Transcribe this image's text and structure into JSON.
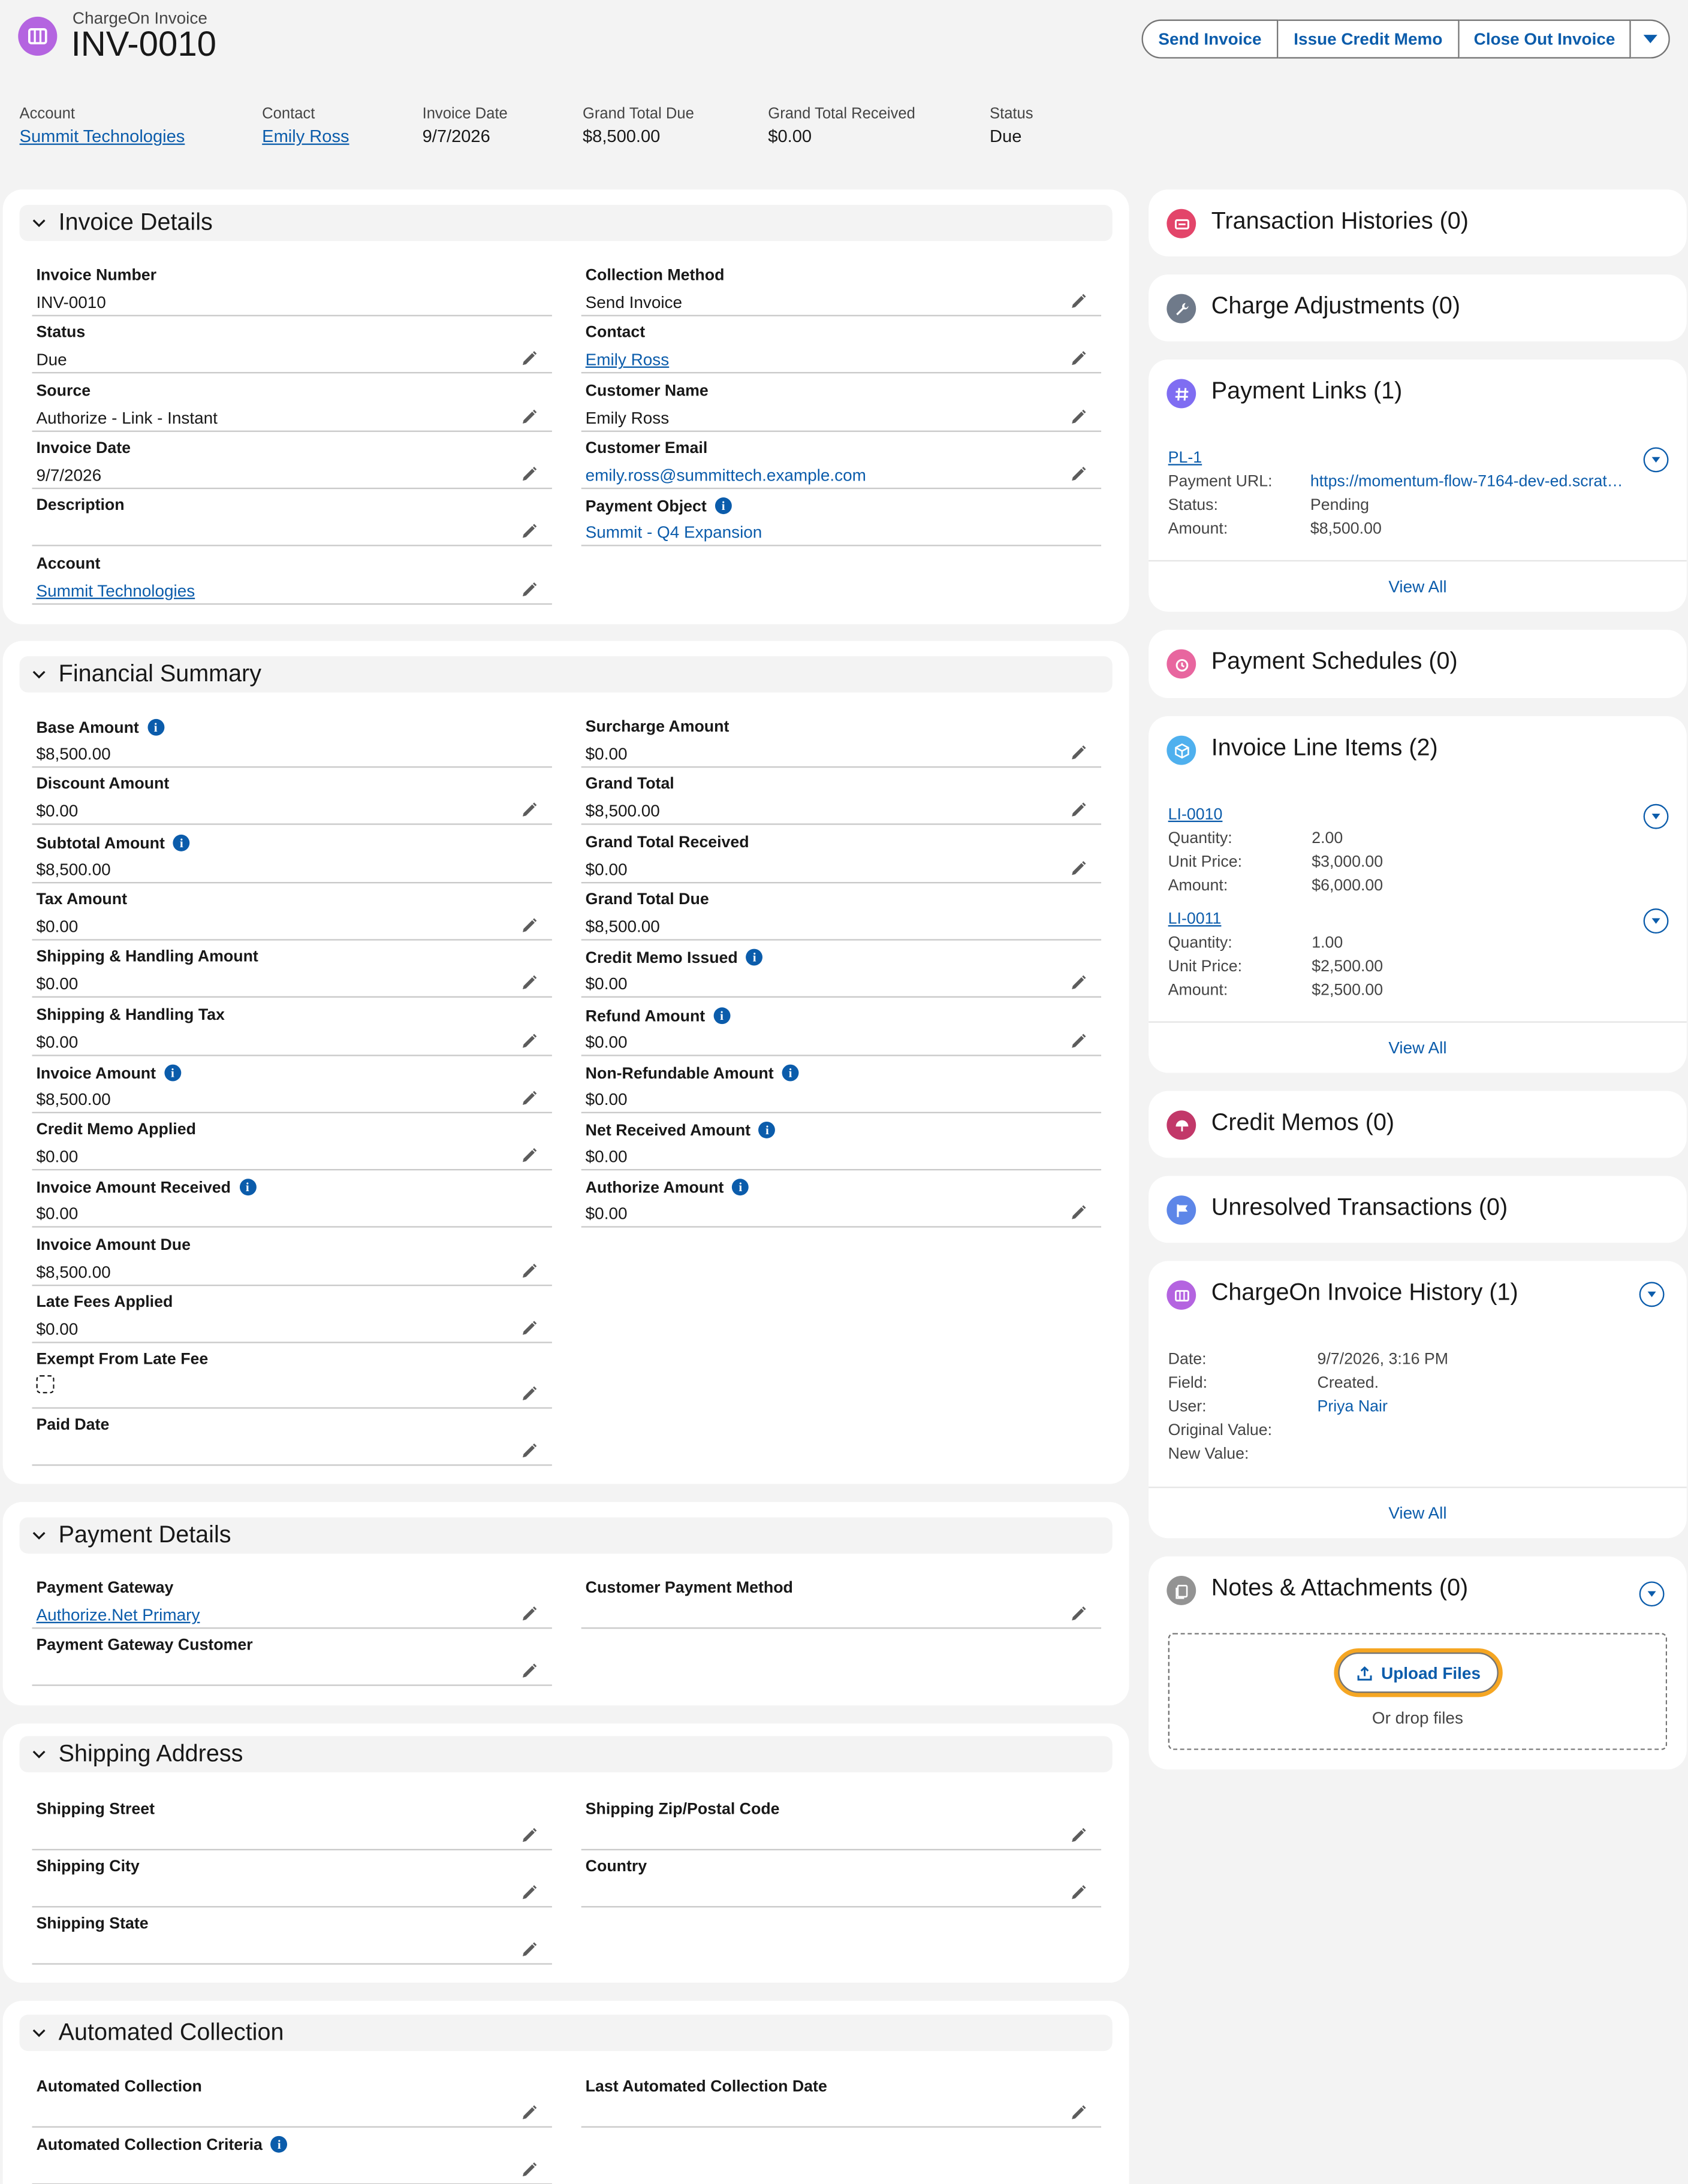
{
  "header": {
    "object_label": "ChargeOn Invoice",
    "title": "INV-0010",
    "buttons": [
      "Send Invoice",
      "Issue Credit Memo",
      "Close Out Invoice"
    ],
    "highlights": [
      {
        "label": "Account",
        "value": "Summit Technologies",
        "link": true
      },
      {
        "label": "Contact",
        "value": "Emily Ross",
        "link": true
      },
      {
        "label": "Invoice Date",
        "value": "9/7/2026",
        "link": false
      },
      {
        "label": "Grand Total Due",
        "value": "$8,500.00",
        "link": false
      },
      {
        "label": "Grand Total Received",
        "value": "$0.00",
        "link": false
      },
      {
        "label": "Status",
        "value": "Due",
        "link": false
      }
    ]
  },
  "invoice_details": {
    "title": "Invoice Details",
    "left": [
      {
        "label": "Invoice Number",
        "value": "INV-0010"
      },
      {
        "label": "Status",
        "value": "Due"
      },
      {
        "label": "Source",
        "value": "Authorize - Link - Instant"
      },
      {
        "label": "Invoice Date",
        "value": "9/7/2026"
      },
      {
        "label": "Description",
        "value": ""
      },
      {
        "label": "Account",
        "value": "Summit Technologies"
      }
    ],
    "right": [
      {
        "label": "Collection Method",
        "value": "Send Invoice"
      },
      {
        "label": "Contact",
        "value": "Emily Ross"
      },
      {
        "label": "Customer Name",
        "value": "Emily Ross"
      },
      {
        "label": "Customer Email",
        "value": "emily.ross@summittech.example.com"
      },
      {
        "label": "Payment Object",
        "value": "Summit - Q4 Expansion"
      }
    ]
  },
  "financial_summary": {
    "title": "Financial Summary",
    "left": [
      {
        "label": "Base Amount",
        "value": "$8,500.00"
      },
      {
        "label": "Discount Amount",
        "value": "$0.00"
      },
      {
        "label": "Subtotal Amount",
        "value": "$8,500.00"
      },
      {
        "label": "Tax Amount",
        "value": "$0.00"
      },
      {
        "label": "Shipping & Handling Amount",
        "value": "$0.00"
      },
      {
        "label": "Shipping & Handling Tax",
        "value": "$0.00"
      },
      {
        "label": "Invoice Amount",
        "value": "$8,500.00"
      },
      {
        "label": "Credit Memo Applied",
        "value": "$0.00"
      },
      {
        "label": "Invoice Amount Received",
        "value": "$0.00"
      },
      {
        "label": "Invoice Amount Due",
        "value": "$8,500.00"
      },
      {
        "label": "Late Fees Applied",
        "value": "$0.00"
      },
      {
        "label": "Exempt From Late Fee",
        "value": ""
      },
      {
        "label": "Paid Date",
        "value": ""
      }
    ],
    "right": [
      {
        "label": "Surcharge Amount",
        "value": "$0.00"
      },
      {
        "label": "Grand Total",
        "value": "$8,500.00"
      },
      {
        "label": "Grand Total Received",
        "value": "$0.00"
      },
      {
        "label": "Grand Total Due",
        "value": "$8,500.00"
      },
      {
        "label": "Credit Memo Issued",
        "value": "$0.00"
      },
      {
        "label": "Refund Amount",
        "value": "$0.00"
      },
      {
        "label": "Non-Refundable Amount",
        "value": "$0.00"
      },
      {
        "label": "Net Received Amount",
        "value": "$0.00"
      },
      {
        "label": "Authorize Amount",
        "value": "$0.00"
      }
    ]
  },
  "payment_details": {
    "title": "Payment Details",
    "fields": [
      {
        "label": "Payment Gateway",
        "value": "Authorize.Net Primary"
      },
      {
        "label": "Customer Payment Method",
        "value": ""
      },
      {
        "label": "Payment Gateway Customer",
        "value": ""
      }
    ]
  },
  "shipping_address": {
    "title": "Shipping Address",
    "fields": [
      {
        "label": "Shipping Street",
        "value": ""
      },
      {
        "label": "Shipping Zip/Postal Code",
        "value": ""
      },
      {
        "label": "Shipping City",
        "value": ""
      },
      {
        "label": "Country",
        "value": ""
      },
      {
        "label": "Shipping State",
        "value": ""
      }
    ]
  },
  "automated_collection": {
    "title": "Automated Collection",
    "fields": [
      {
        "label": "Automated Collection",
        "value": ""
      },
      {
        "label": "Last Automated Collection Date",
        "value": ""
      },
      {
        "label": "Automated Collection Criteria",
        "value": ""
      }
    ]
  },
  "related": {
    "transaction_histories": "Transaction Histories (0)",
    "charge_adjustments": "Charge Adjustments (0)",
    "payment_links": {
      "title": "Payment Links (1)",
      "item": {
        "name": "PL-1",
        "url_label": "Payment URL:",
        "url": "https://momentum-flow-7164-dev-ed.scrat…",
        "status_label": "Status:",
        "status": "Pending",
        "amount_label": "Amount:",
        "amount": "$8,500.00"
      }
    },
    "payment_schedules": "Payment Schedules (0)",
    "invoice_line_items": {
      "title": "Invoice Line Items (2)",
      "items": [
        {
          "name": "LI-0010",
          "quantity": "2.00",
          "unit_price": "$3,000.00",
          "amount": "$6,000.00"
        },
        {
          "name": "LI-0011",
          "quantity": "1.00",
          "unit_price": "$2,500.00",
          "amount": "$2,500.00"
        }
      ],
      "labels": {
        "quantity": "Quantity:",
        "unit_price": "Unit Price:",
        "amount": "Amount:"
      }
    },
    "credit_memos": "Credit Memos (0)",
    "unresolved_transactions": "Unresolved Transactions (0)",
    "invoice_history": {
      "title": "ChargeOn Invoice History (1)",
      "labels": {
        "date": "Date:",
        "field": "Field:",
        "user": "User:",
        "original": "Original Value:",
        "new": "New Value:"
      },
      "date": "9/7/2026, 3:16 PM",
      "field": "Created.",
      "user": "Priya Nair"
    },
    "notes": {
      "title": "Notes & Attachments (0)",
      "upload_label": "Upload Files",
      "drop_label": "Or drop files"
    },
    "view_all": "View All"
  },
  "colors": {
    "link": "#0b5cab",
    "invoice_icon": "#b464e0",
    "transaction_icon": "#e3456a",
    "adjustment_icon": "#7e8be4",
    "payment_links_icon": "#7f6df2",
    "schedules_icon": "#e8669f",
    "line_items_icon": "#4fb0ee",
    "credit_memo_icon": "#c23869",
    "unresolved_icon": "#5d86e8",
    "notes_icon": "#939393",
    "upload_focus": "#f5a623"
  }
}
